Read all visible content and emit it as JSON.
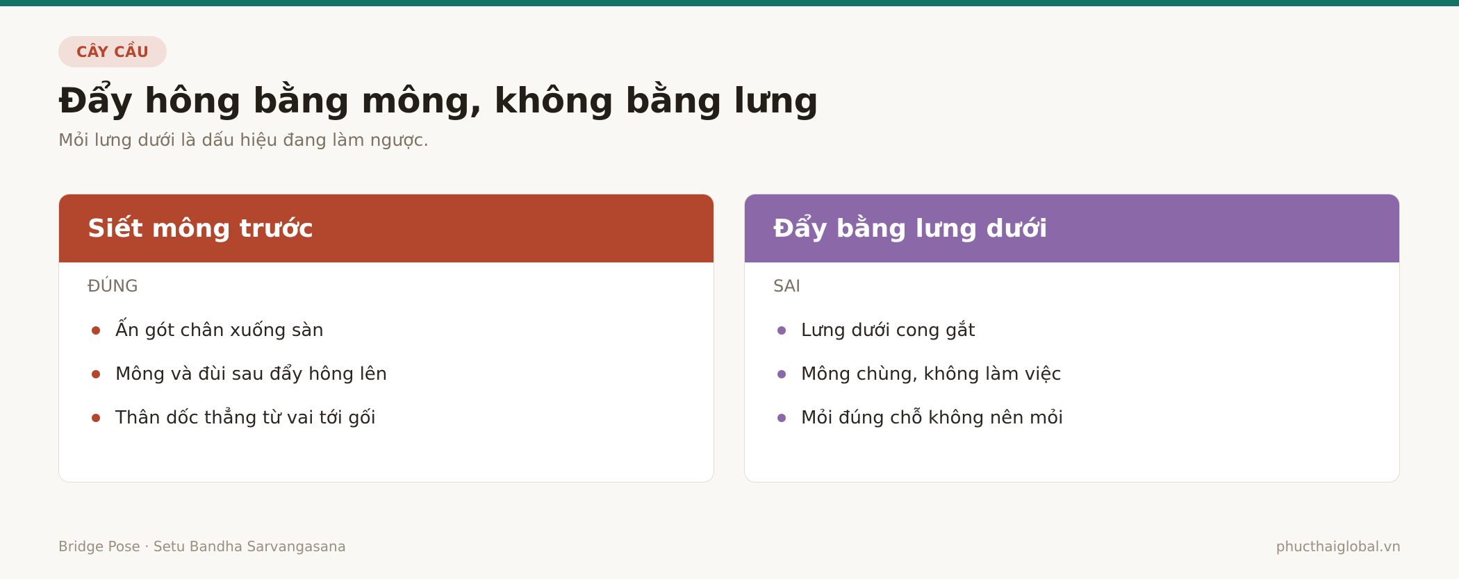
{
  "colors": {
    "top_bar": "#137466",
    "accent_correct": "#b3472e",
    "accent_wrong": "#8b68a8",
    "badge_bg": "#f2dfd9",
    "background": "#faf8f4"
  },
  "header": {
    "badge": "CÂY CẦU",
    "title": "Đẩy hông bằng mông, không bằng lưng",
    "subtitle": "Mỏi lưng dưới là dấu hiệu đang làm ngược."
  },
  "cards": [
    {
      "title": "Siết mông trước",
      "verdict": "ĐÚNG",
      "items": [
        "Ấn gót chân xuống sàn",
        "Mông và đùi sau đẩy hông lên",
        "Thân dốc thẳng từ vai tới gối"
      ]
    },
    {
      "title": "Đẩy bằng lưng dưới",
      "verdict": "SAI",
      "items": [
        "Lưng dưới cong gắt",
        "Mông chùng, không làm việc",
        "Mỏi đúng chỗ không nên mỏi"
      ]
    }
  ],
  "footer": {
    "left": "Bridge Pose · Setu Bandha Sarvangasana",
    "right": "phucthaiglobal.vn"
  }
}
